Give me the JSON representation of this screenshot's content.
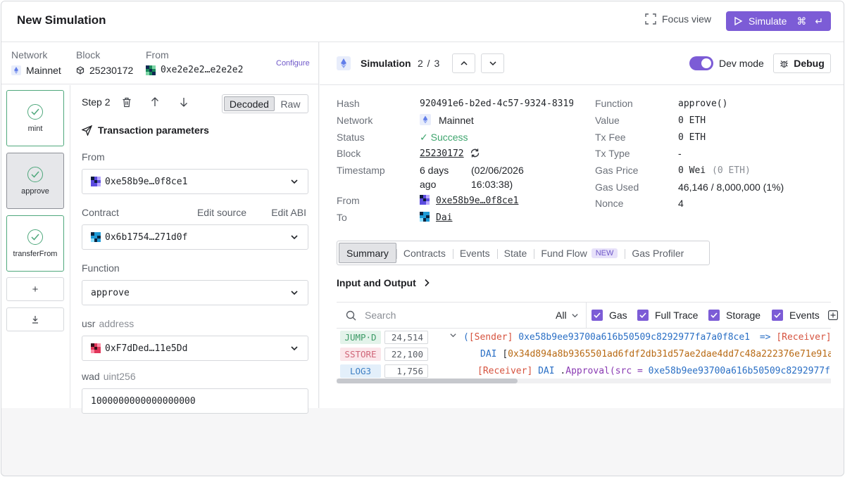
{
  "header": {
    "title": "New Simulation",
    "focus_view": "Focus view",
    "simulate": "Simulate",
    "simulate_shortcut": "⌘ ↵"
  },
  "network_bar": {
    "network_label": "Network",
    "network_value": "Mainnet",
    "block_label": "Block",
    "block_value": "25230172",
    "from_label": "From",
    "from_value": "0xe2e2e2…e2e2e2",
    "configure": "Configure"
  },
  "steps": [
    {
      "label": "mint"
    },
    {
      "label": "approve"
    },
    {
      "label": "transferFrom"
    }
  ],
  "step_actions": {
    "add": "+",
    "download": "⤓"
  },
  "form": {
    "step_title": "Step 2",
    "decoded": "Decoded",
    "raw": "Raw",
    "tx_params": "Transaction parameters",
    "from_label": "From",
    "from_value": "0xe58b9e…0f8ce1",
    "contract_label": "Contract",
    "edit_source": "Edit source",
    "edit_abi": "Edit ABI",
    "contract_value": "0x6b1754…271d0f",
    "function_label": "Function",
    "function_value": "approve",
    "usr_label": "usr",
    "usr_type": "address",
    "usr_value": "0xF7dDed…11e5Dd",
    "wad_label": "wad",
    "wad_type": "uint256",
    "wad_value": "1000000000000000000"
  },
  "sim_bar": {
    "title": "Simulation",
    "count": "2 / 3",
    "dev_mode": "Dev mode",
    "debug": "Debug"
  },
  "details_left": {
    "hash_label": "Hash",
    "hash_value": "920491e6-b2ed-4c57-9324-8319",
    "network_label": "Network",
    "network_value": "Mainnet",
    "status_label": "Status",
    "status_value": "✓ Success",
    "block_label": "Block",
    "block_value": "25230172",
    "timestamp_label": "Timestamp",
    "timestamp_rel_1": "6 days",
    "timestamp_rel_2": "ago",
    "timestamp_abs_1": "(02/06/2026",
    "timestamp_abs_2": "16:03:38)",
    "from_label": "From",
    "from_value": "0xe58b9e…0f8ce1",
    "to_label": "To",
    "to_value": "Dai"
  },
  "details_right": {
    "function_label": "Function",
    "function_value": "approve()",
    "value_label": "Value",
    "value_value": "0 ETH",
    "fee_label": "Tx Fee",
    "fee_value": "0 ETH",
    "type_label": "Tx Type",
    "type_value": "-",
    "gas_price_label": "Gas Price",
    "gas_price_value": "0 Wei",
    "gas_price_eth": "(0 ETH)",
    "gas_used_label": "Gas Used",
    "gas_used_value": "46,146 / 8,000,000 (1%)",
    "nonce_label": "Nonce",
    "nonce_value": "4"
  },
  "tabs": {
    "summary": "Summary",
    "contracts": "Contracts",
    "events": "Events",
    "state": "State",
    "fund_flow": "Fund Flow",
    "new_badge": "NEW",
    "gas_profiler": "Gas Profiler"
  },
  "io_title": "Input and Output",
  "trace_filters": {
    "search_placeholder": "Search",
    "all": "All",
    "gas": "Gas",
    "full_trace": "Full Trace",
    "storage": "Storage",
    "events": "Events"
  },
  "trace_rows": [
    {
      "op": "JUMP·D",
      "gas": "24,514",
      "sender": "[Sender]",
      "sender_addr": "0xe58b9ee93700a616b50509c8292977fa7a0f8ce1",
      "arrow": "=>",
      "receiver": "[Receiver]"
    },
    {
      "op": "SSTORE",
      "gas": "22,100",
      "contract": "DAI",
      "bracket": "[",
      "slot": "0x34d894a8b9365501ad6fdf2db31d57ae2dae4dd7c48a222376e71e91a"
    },
    {
      "op": "LOG3",
      "gas": "1,756",
      "receiver": "[Receiver]",
      "contract": "DAI",
      "dot": ".",
      "event": "Approval",
      "args": "(src = ",
      "src": "0xe58b9ee93700a616b50509c8292977f"
    }
  ],
  "colors": {
    "accent": "#7c5cd6",
    "success": "#3ea56e"
  }
}
